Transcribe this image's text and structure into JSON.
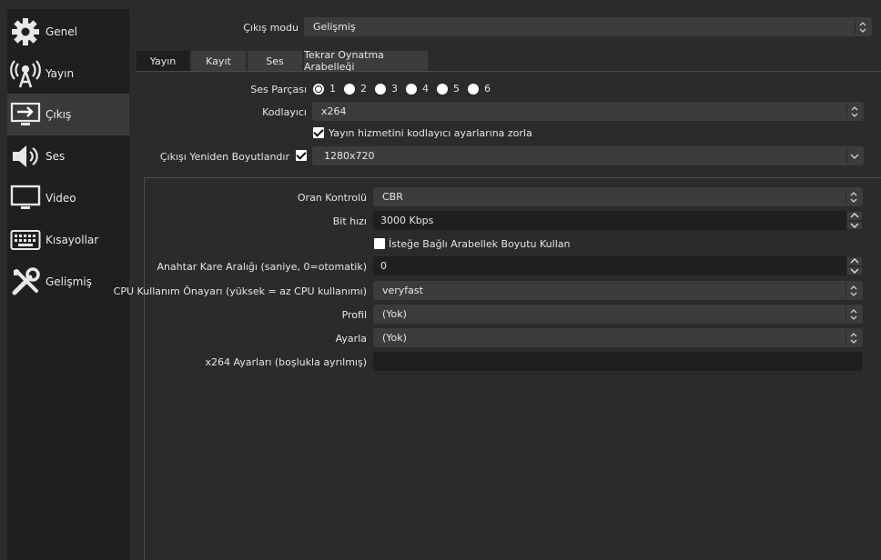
{
  "sidebar": {
    "items": [
      {
        "label": "Genel",
        "icon": "gear-icon"
      },
      {
        "label": "Yayın",
        "icon": "broadcast-antenna-icon"
      },
      {
        "label": "Çıkış",
        "icon": "output-monitor-icon",
        "active": true
      },
      {
        "label": "Ses",
        "icon": "speaker-icon"
      },
      {
        "label": "Video",
        "icon": "monitor-icon"
      },
      {
        "label": "Kısayollar",
        "icon": "keyboard-icon"
      },
      {
        "label": "Gelişmiş",
        "icon": "tools-icon"
      }
    ]
  },
  "output_mode": {
    "label": "Çıkış modu",
    "value": "Gelişmiş"
  },
  "tabs": [
    "Yayın",
    "Kayıt",
    "Ses",
    "Tekrar Oynatma Arabelleği"
  ],
  "audio_track": {
    "label": "Ses Parçası",
    "options": [
      "1",
      "2",
      "3",
      "4",
      "5",
      "6"
    ],
    "selected": "1"
  },
  "encoder": {
    "label": "Kodlayıcı",
    "value": "x264"
  },
  "enforce": {
    "label": "Yayın hizmetini kodlayıcı ayarlarına zorla",
    "checked": true
  },
  "rescale": {
    "label": "Çıkışı Yeniden Boyutlandır",
    "checked": true,
    "value": "1280x720"
  },
  "encoder_settings": {
    "rate_control": {
      "label": "Oran Kontrolü",
      "value": "CBR"
    },
    "bitrate": {
      "label": "Bit hızı",
      "value": "3000 Kbps"
    },
    "custom_buffer": {
      "label": "İsteğe Bağlı Arabellek Boyutu Kullan",
      "checked": false
    },
    "keyframe": {
      "label": "Anahtar Kare Aralığı (saniye, 0=otomatik)",
      "value": "0"
    },
    "cpu_preset": {
      "label": "CPU Kullanım Önayarı (yüksek = az CPU kullanımı)",
      "value": "veryfast"
    },
    "profile": {
      "label": "Profil",
      "value": "(Yok)"
    },
    "tune": {
      "label": "Ayarla",
      "value": "(Yok)"
    },
    "x264_options": {
      "label": "x264 Ayarları (boşlukla ayrılmış)",
      "value": ""
    }
  },
  "colors": {
    "background": "#2b2b2b",
    "sidebar": "#1f1f1f",
    "control": "#3c3c3c",
    "input": "#1f1f1f"
  }
}
